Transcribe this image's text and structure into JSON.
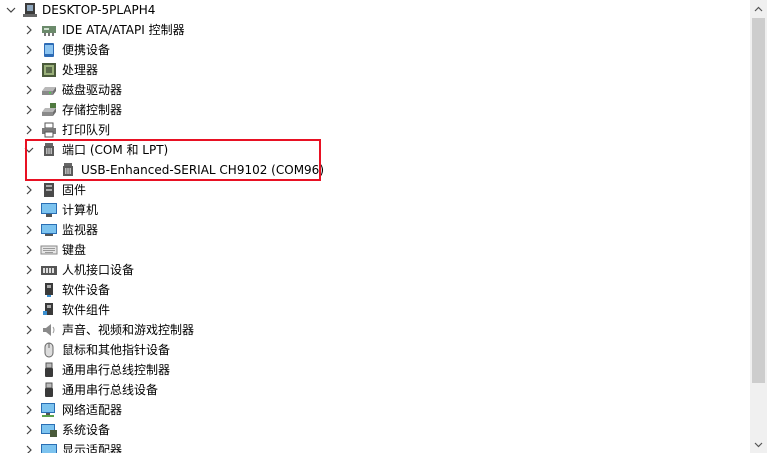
{
  "root": {
    "label": "DESKTOP-5PLAPH4"
  },
  "items": [
    {
      "label": "IDE ATA/ATAPI 控制器"
    },
    {
      "label": "便携设备"
    },
    {
      "label": "处理器"
    },
    {
      "label": "磁盘驱动器"
    },
    {
      "label": "存储控制器"
    },
    {
      "label": "打印队列"
    },
    {
      "label": "端口 (COM 和 LPT)"
    },
    {
      "label": "USB-Enhanced-SERIAL CH9102 (COM96)"
    },
    {
      "label": "固件"
    },
    {
      "label": "计算机"
    },
    {
      "label": "监视器"
    },
    {
      "label": "键盘"
    },
    {
      "label": "人机接口设备"
    },
    {
      "label": "软件设备"
    },
    {
      "label": "软件组件"
    },
    {
      "label": "声音、视频和游戏控制器"
    },
    {
      "label": "鼠标和其他指针设备"
    },
    {
      "label": "通用串行总线控制器"
    },
    {
      "label": "通用串行总线设备"
    },
    {
      "label": "网络适配器"
    },
    {
      "label": "系统设备"
    },
    {
      "label": "显示适配器"
    }
  ],
  "colors": {
    "highlight": "#e81123",
    "scrollbar_track": "#f0f0f0",
    "scrollbar_thumb": "#cdcdcd"
  }
}
